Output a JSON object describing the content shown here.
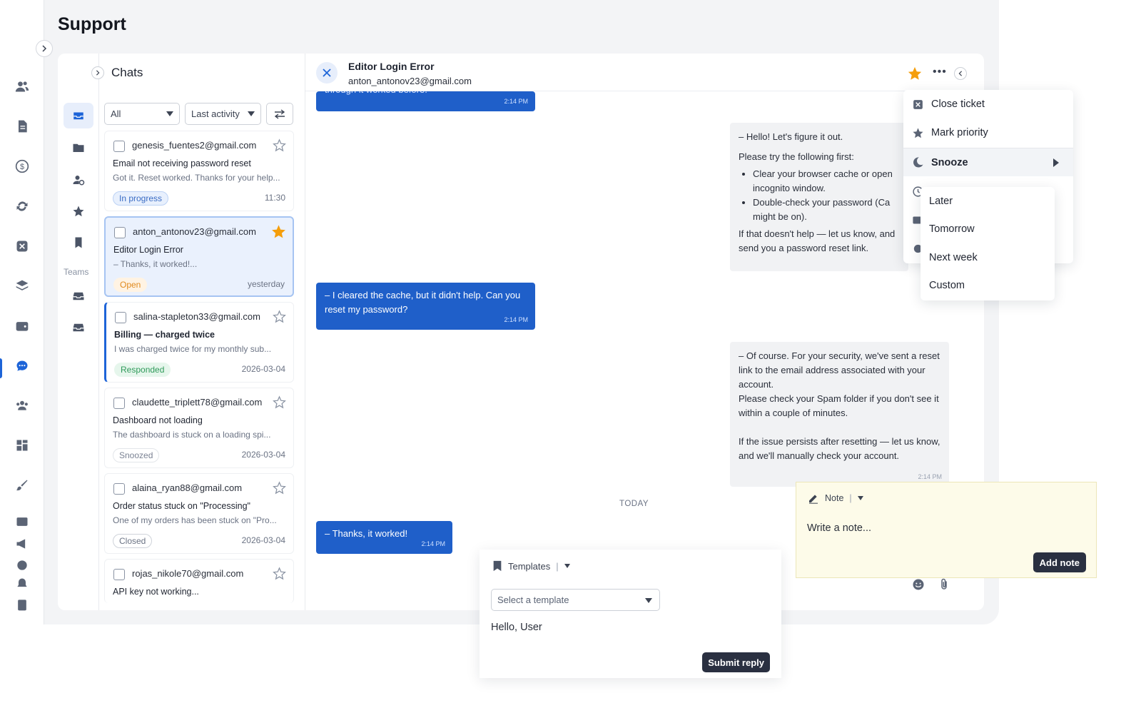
{
  "page": {
    "title": "Support"
  },
  "chats": {
    "title": "Chats",
    "teams_label": "Teams",
    "filters": {
      "status": "All",
      "sort": "Last activity"
    },
    "items": [
      {
        "email": "genesis_fuentes2@gmail.com",
        "subject": "Email not receiving password reset",
        "snippet": "Got it. Reset worked. Thanks for your help...",
        "badge": "In progress",
        "time": "11:30",
        "starred": false
      },
      {
        "email": "anton_antonov23@gmail.com",
        "subject": "Editor Login Error",
        "snippet": "– Thanks, it worked!...",
        "badge": "Open",
        "time": "yesterday",
        "starred": true
      },
      {
        "email": "salina-stapleton33@gmail.com",
        "subject": "Billing — charged twice",
        "snippet": "I was charged twice for my monthly sub...",
        "badge": "Responded",
        "time": "2026-03-04",
        "starred": false
      },
      {
        "email": "claudette_triplett78@gmail.com",
        "subject": "Dashboard not loading",
        "snippet": "The dashboard is stuck on a loading spi...",
        "badge": "Snoozed",
        "time": "2026-03-04",
        "starred": false
      },
      {
        "email": "alaina_ryan88@gmail.com",
        "subject": "Order status stuck on \"Processing\"",
        "snippet": "One of my orders has been stuck on \"Pro...",
        "badge": "Closed",
        "time": "2026-03-04",
        "starred": false
      },
      {
        "email": "rojas_nikole70@gmail.com",
        "subject": "API key not working...",
        "snippet": "",
        "badge": "",
        "time": "",
        "starred": false
      }
    ]
  },
  "conversation": {
    "title": "Editor Login Error",
    "email": "anton_antonov23@gmail.com",
    "messages": [
      {
        "text": "through it worked before.",
        "time": "2:14 PM"
      },
      {
        "intro": "– Hello! Let's figure it out.",
        "line2": "Please try the following first:",
        "bullet1": "Clear your browser cache or open incognito window.",
        "bullet2": "Double-check your password (Ca might be on).",
        "outro": "If that doesn't help — let us know, and send you a password reset link."
      },
      {
        "text": "– I cleared the cache, but it didn't help. Can you reset my password?",
        "time": "2:14 PM"
      },
      {
        "p1": "– Of course. For your security, we've sent a reset link to the email address associated with your account.",
        "p2": "Please check your Spam folder if you don't see it within a couple of minutes.",
        "p3": "If the issue persists after resetting — let us know, and we'll manually check your account.",
        "time": "2:14 PM"
      },
      {
        "text": "– Thanks, it worked!",
        "time": "2:14 PM"
      }
    ],
    "divider": "TODAY"
  },
  "menu": {
    "items": [
      "Close ticket",
      "Mark priority",
      "Snooze"
    ],
    "peek_text": "ts",
    "submenu": [
      "Later",
      "Tomorrow",
      "Next week",
      "Custom"
    ]
  },
  "note": {
    "label": "Note",
    "placeholder": "Write a note...",
    "button": "Add note"
  },
  "reply": {
    "label": "Templates",
    "select_placeholder": "Select a template",
    "body": "Hello, User",
    "button": "Submit reply"
  },
  "colors": {
    "accent": "#1d64d8",
    "star": "#f59e0b",
    "dark_button": "#2a3041",
    "note_bg": "#fdfbe9"
  },
  "badge_colors": {
    "In progress": {
      "bg": "#e8f0fd",
      "border": "#bcd2f5",
      "fg": "#3a6cc4"
    },
    "Open": {
      "bg": "#fff3e3",
      "border": "#fff3e3",
      "fg": "#e08a1e"
    },
    "Responded": {
      "bg": "#e6f6ec",
      "border": "#e6f6ec",
      "fg": "#2f9a5a"
    },
    "Snoozed": {
      "bg": "#ffffff",
      "border": "#e3e6ea",
      "fg": "#7a8293"
    },
    "Closed": {
      "bg": "#ffffff",
      "border": "#cfd3da",
      "fg": "#6b7384"
    }
  }
}
